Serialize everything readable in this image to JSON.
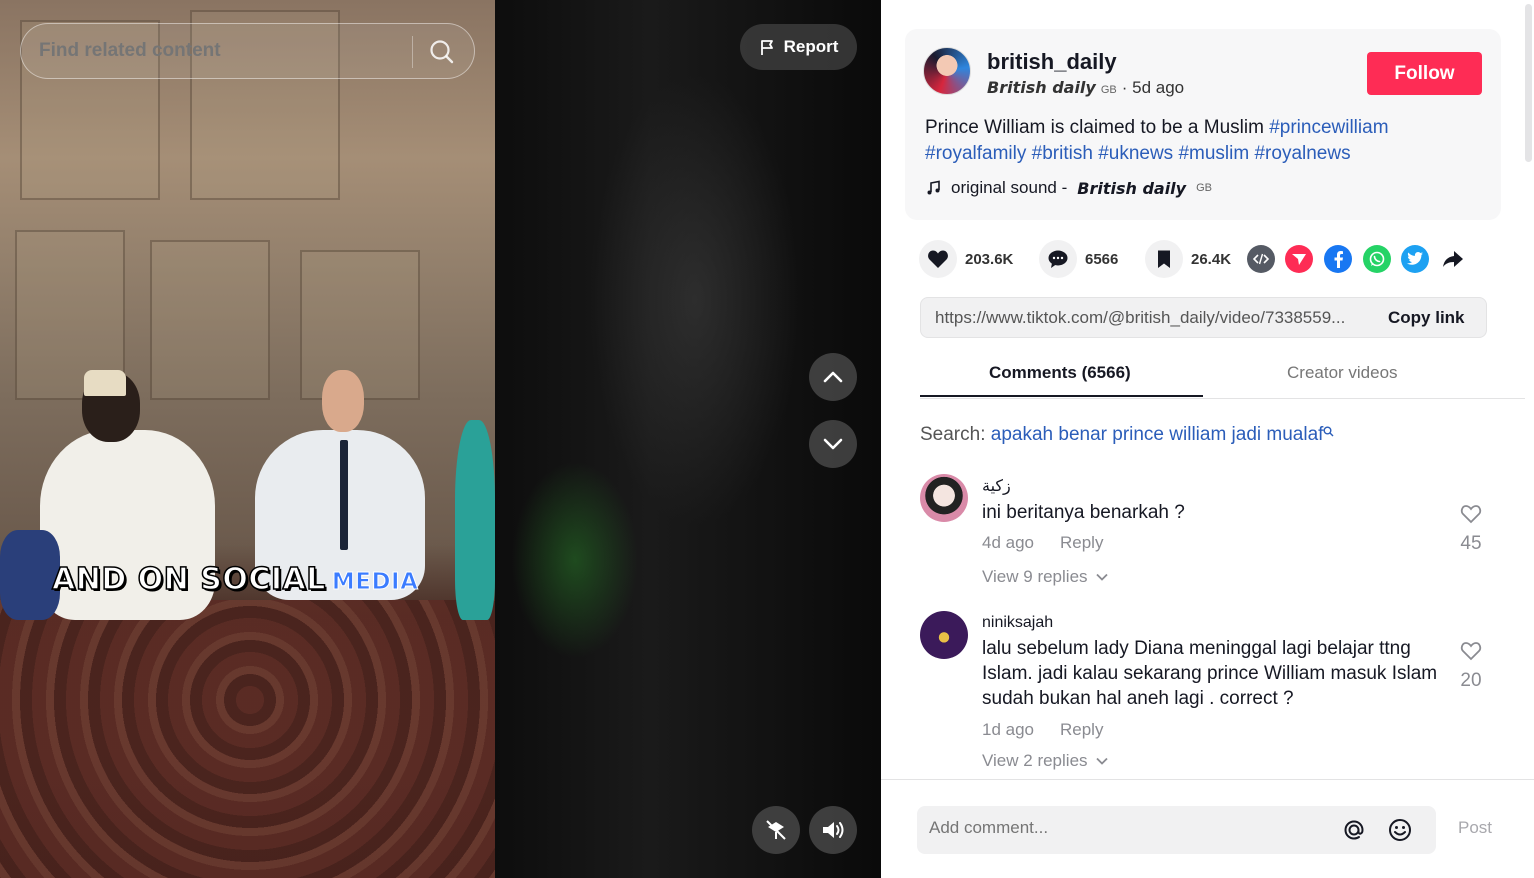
{
  "video": {
    "search_placeholder": "Find related content",
    "report_label": "Report",
    "caption_main": "AND ON SOCIAL",
    "caption_highlight": "MEDIA"
  },
  "post": {
    "username": "british_daily",
    "nickname": "British daily",
    "nickname_flag": "GB",
    "age": "· 5d ago",
    "follow_label": "Follow",
    "description": "Prince William is claimed to be a Muslim",
    "hashtags": [
      "#princewilliam",
      "#royalfamily",
      "#british",
      "#uknews",
      "#muslim",
      "#royalnews"
    ],
    "sound_prefix": "original sound -",
    "sound_author": "British daily",
    "sound_flag": "GB"
  },
  "actions": {
    "likes": "203.6K",
    "comments": "6566",
    "saves": "26.4K"
  },
  "link": {
    "url": "https://www.tiktok.com/@british_daily/video/7338559...",
    "copy_label": "Copy link"
  },
  "tabs": [
    {
      "label": "Comments (6566)",
      "active": true
    },
    {
      "label": "Creator videos",
      "active": false
    }
  ],
  "search_suggestion": {
    "prefix": "Search:",
    "query": "apakah benar prince william jadi mualaf"
  },
  "comments": [
    {
      "user": "زكية",
      "text": "ini beritanya benarkah ?",
      "time": "4d ago",
      "reply_label": "Reply",
      "likes": "45",
      "view_replies": "View 9 replies"
    },
    {
      "user": "niniksajah",
      "text": "lalu sebelum lady Diana meninggal lagi belajar ttng Islam. jadi kalau sekarang prince William masuk Islam sudah bukan hal aneh lagi . correct ?",
      "time": "1d ago",
      "reply_label": "Reply",
      "likes": "20",
      "view_replies": "View 2 replies"
    }
  ],
  "footer": {
    "comment_placeholder": "Add comment...",
    "post_label": "Post"
  },
  "colors": {
    "accent": "#fe2c55",
    "hashtag": "#2b5db9",
    "muted": "#8a8b91"
  }
}
